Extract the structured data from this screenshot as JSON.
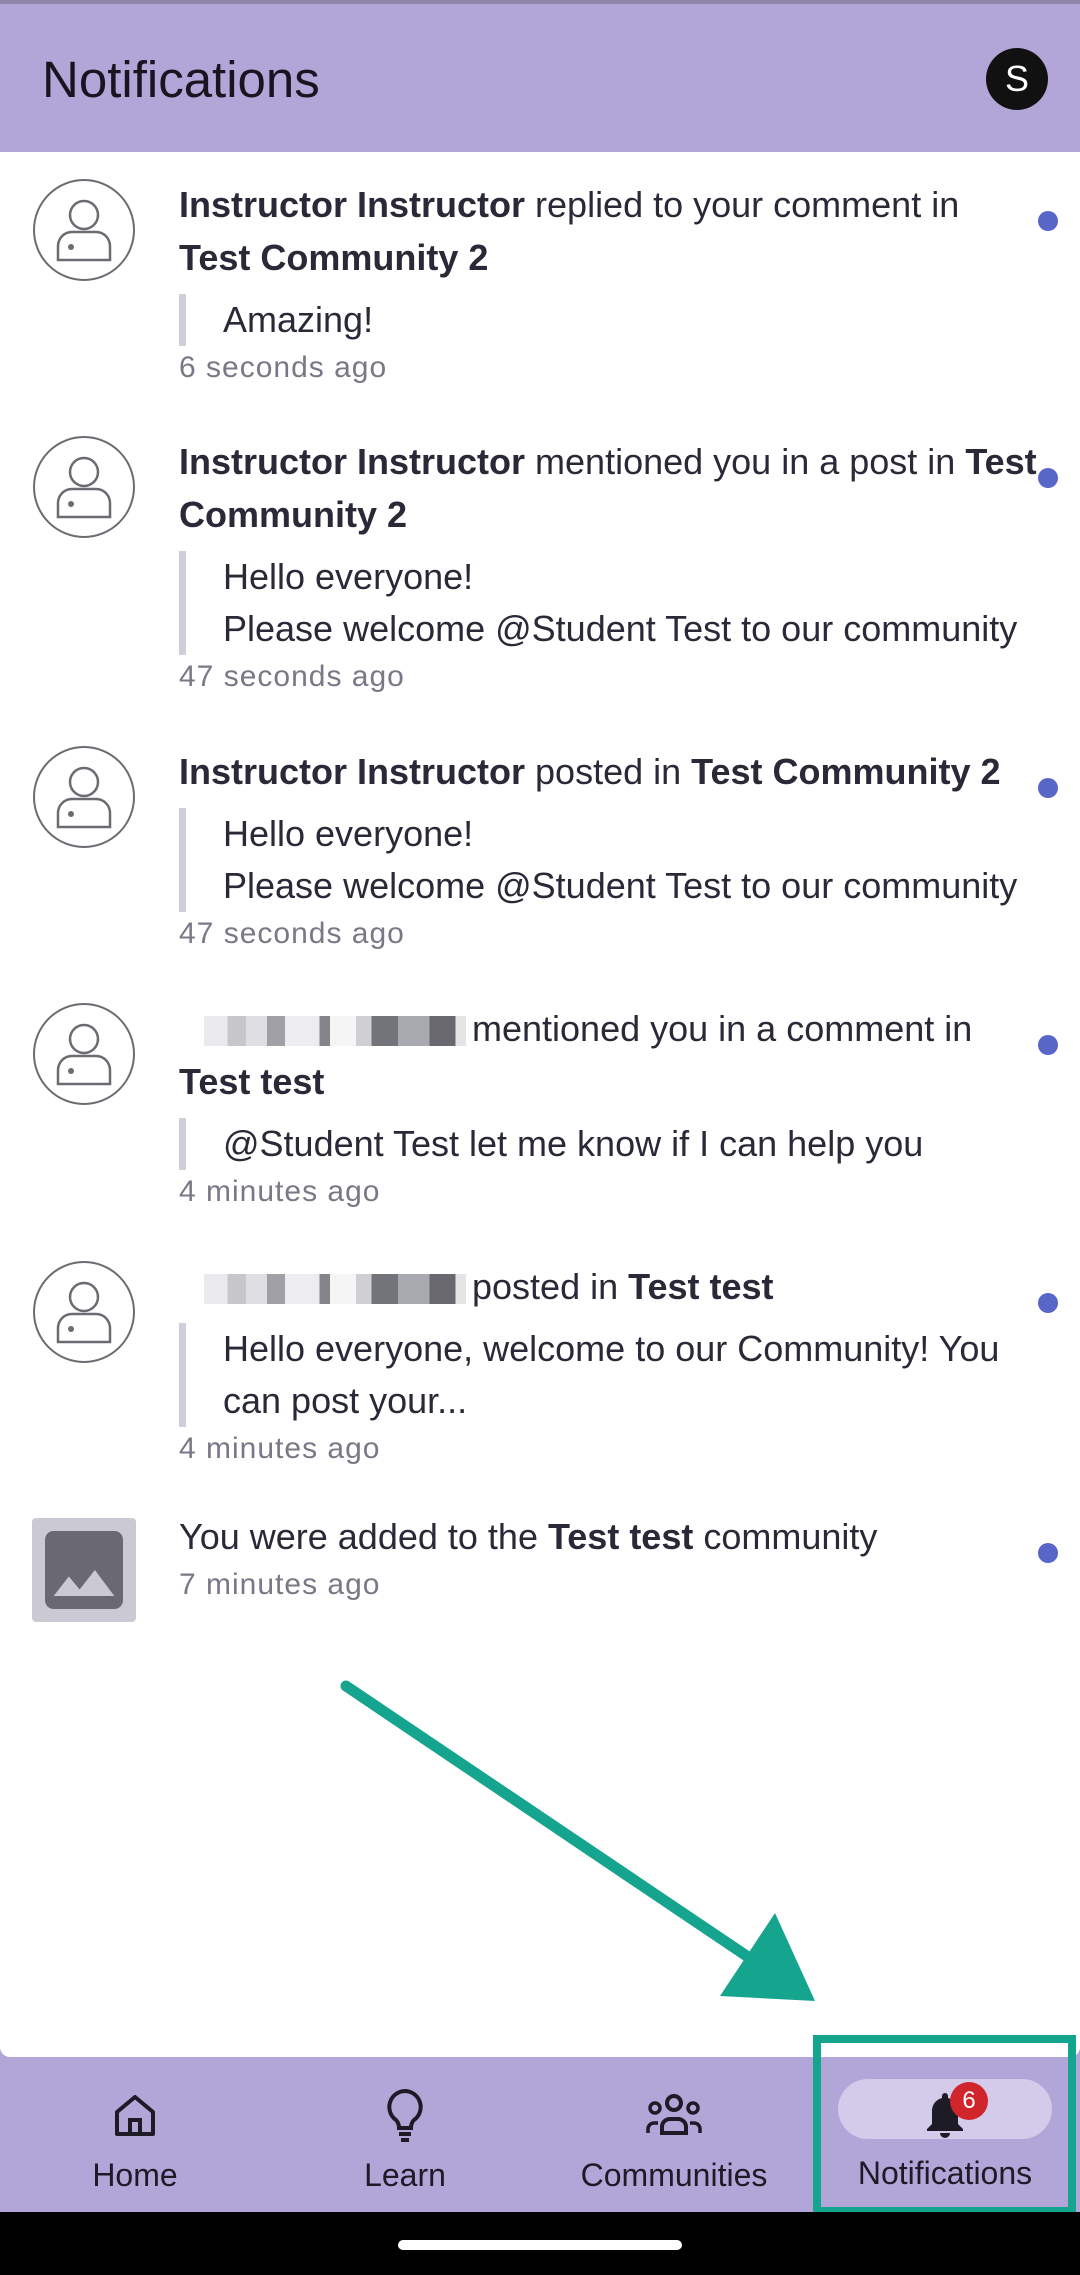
{
  "header": {
    "title": "Notifications",
    "avatar_letter": "S"
  },
  "notifications": [
    {
      "actor": "Instructor Instructor",
      "action": " replied to your comment in",
      "target": "Test Community 2",
      "quote": [
        "Amazing!"
      ],
      "time": "6 seconds ago"
    },
    {
      "actor": "Instructor Instructor",
      "action": " mentioned you in a post in ",
      "target_line1": "Test",
      "target_line2": "Community 2",
      "quote": [
        "Hello everyone!",
        "Please welcome @Student Test to our community"
      ],
      "time": "47 seconds ago"
    },
    {
      "actor": "Instructor Instructor",
      "action": " posted in ",
      "target": "Test Community 2",
      "quote": [
        "Hello everyone!",
        "Please welcome @Student Test to our community"
      ],
      "time": "47 seconds ago"
    },
    {
      "action": "mentioned you in a comment in",
      "target": "Test test",
      "quote": [
        "@Student Test let me know if I can help you"
      ],
      "time": "4 minutes ago"
    },
    {
      "action": "posted in ",
      "target": "Test test",
      "quote": [
        "Hello everyone, welcome to our Community! You",
        "can post your..."
      ],
      "time": "4 minutes ago"
    },
    {
      "prefix": "You were added to the ",
      "target": "Test test",
      "suffix": " community",
      "time": "7 minutes ago"
    }
  ],
  "nav": {
    "home": "Home",
    "learn": "Learn",
    "communities": "Communities",
    "notifications": "Notifications",
    "badge_count": "6"
  },
  "colors": {
    "header_bg": "#b2a6d9",
    "unread_dot": "#5866c8",
    "badge": "#d1252c",
    "annotation": "#15a58f"
  }
}
